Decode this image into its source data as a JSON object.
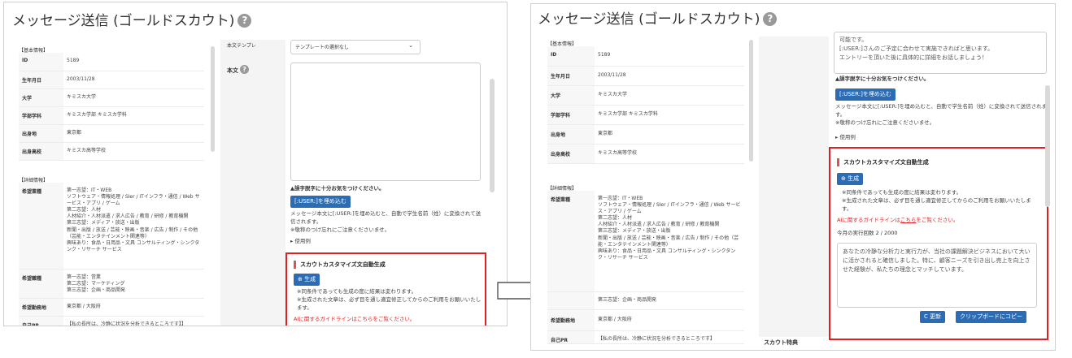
{
  "left": {
    "title": "メッセージ送信 (ゴールドスカウト)",
    "help_icon": "?",
    "basic_label": "【基本情報】",
    "detail_label": "【詳細情報】",
    "basic": [
      {
        "k": "ID",
        "v": "5189"
      },
      {
        "k": "生年月日",
        "v": "2003/11/28"
      },
      {
        "k": "大学",
        "v": "キミスカ大学"
      },
      {
        "k": "学部学科",
        "v": "キミスカ学部 キミスカ学科"
      },
      {
        "k": "出身地",
        "v": "東京都"
      },
      {
        "k": "出身高校",
        "v": "キミスカ高等学校"
      }
    ],
    "detail": [
      {
        "k": "希望業種",
        "v": "第一志望：IT・WEB\nソフトウェア・情報処理 / SIer / ITインフラ・通信 / Web サービス・アプリ / ゲーム\n第二志望：人材\n人材紹介・人材派遣 / 求人広告 / 教育 / 研修 / 教育機関\n第三志望：メディア・放送・出版\n新聞・出版 / 放送 / 芸能・映画・音楽 / 広告 / 制作 / その他（芸能・エンタテインメント関連等）\n興味あり：食品・日用品・文具 コンサルティング・シンクタンク・リサーチ サービス"
      },
      {
        "k": "希望職種",
        "v": "第一志望：営業\n第二志望：マーケティング\n第三志望：企画・商品開発"
      },
      {
        "k": "希望勤務地",
        "v": "東京都 / 大阪府"
      },
      {
        "k": "自己PR",
        "v": "【私の長所は、冷静に状況を分析できるところです】】"
      }
    ],
    "template_label": "本文テンプレ",
    "template_value": "テンプレートの選択なし",
    "body_label": "本文",
    "typo_note": "▲誤字脱字に十分お気をつけください。",
    "embed_btn": "[:USER:]を埋め込む",
    "embed_note": "メッセージ本文に[:USER:]を埋め込むと、自動で学生名前（姓）に変換されて送信されます。\n※敬称のつけ忘れにご注意くださいませ。",
    "usage": "▸ 使用例",
    "ai_header": "スカウトカスタマイズ文自動生成",
    "gen_btn": "⊕ 生成",
    "gen_note": "※同条件であっても生成の度に結果は変わります。\n※生成された文章は、必ず目を通し適宜修正してからのご利用をお願いいたします。",
    "guideline": "AIに関するガイドラインはこちらをご覧ください。"
  },
  "right": {
    "title": "メッセージ送信 (ゴールドスカウト)",
    "help_icon": "?",
    "basic_label": "【基本情報】",
    "detail_label": "【詳細情報】",
    "basic": [
      {
        "k": "ID",
        "v": "5189"
      },
      {
        "k": "生年月日",
        "v": "2003/11/28"
      },
      {
        "k": "大学",
        "v": "キミスカ大学"
      },
      {
        "k": "学部学科",
        "v": "キミスカ学部 キミスカ学科"
      },
      {
        "k": "出身地",
        "v": "東京都"
      },
      {
        "k": "出身高校",
        "v": "キミスカ高等学校"
      }
    ],
    "detail": [
      {
        "k": "希望業種",
        "v": "第一志望：IT・WEB\nソフトウェア・情報処理 / SIer / ITインフラ・通信 / Web サービス・アプリ / ゲーム\n第二志望：人材\n人材紹介・人材派遣 / 求人広告 / 教育 / 研修 / 教育機関\n第三志望：メディア・放送・出版\n新聞・出版 / 放送 / 芸能・映画・音楽 / 広告 / 制作 / その他（芸能・エンタテインメント関連等）\n興味あり：食品・日用品・文具 コンサルティング・シンクタンク・リサーチ サービス"
      },
      {
        "k": "",
        "v": "第三志望：企画・商品開発"
      },
      {
        "k": "希望勤務地",
        "v": "東京都 / 大阪府"
      },
      {
        "k": "自己PR",
        "v": "【私の長所は、冷静に状況を分析できるところです】"
      }
    ],
    "top_text": "可能です。\n[:USER:]さんのご予定に合わせて実施できればと思います。\nエントリーを頂いた後に具体的に詳細をお話しましょう！",
    "typo_note": "▲誤字脱字に十分お気をつけください。",
    "embed_btn": "[:USER:]を埋め込む",
    "embed_note": "メッセージ本文に[:USER:]を埋め込むと、自動で学生名前（姓）に変換されて送信されます。\n※敬称のつけ忘れにご注意くださいませ。",
    "usage": "▸ 使用例",
    "ai_header": "スカウトカスタマイズ文自動生成",
    "gen_btn": "⊕ 生成",
    "gen_note": "※同条件であっても生成の度に結果は変わります。\n※生成された文章は、必ず目を通し適宜修正してからのご利用をお願いいたします。",
    "guideline_pre": "AIに関するガイドラインは",
    "guideline_link": "こちら",
    "guideline_post": "をご覧ください。",
    "monthly": "今月の実行回数 2 / 2000",
    "generated": "あなたの冷静な分析力と実行力が、当社の課題解決ビジネスにおいて大いに活かされると確信しました。特に、顧客ニーズを引き出し売上を向上させた経験が、私たちの理念とマッチしています。",
    "refresh_btn": "C 更新",
    "copy_btn": "クリップボードにコピー",
    "scout_label": "スカウト特典"
  },
  "colors": {
    "accent": "#2b6cb5",
    "highlight": "#e02020"
  },
  "icons": {
    "help": "help-icon",
    "arrow": "right-arrow-icon"
  }
}
